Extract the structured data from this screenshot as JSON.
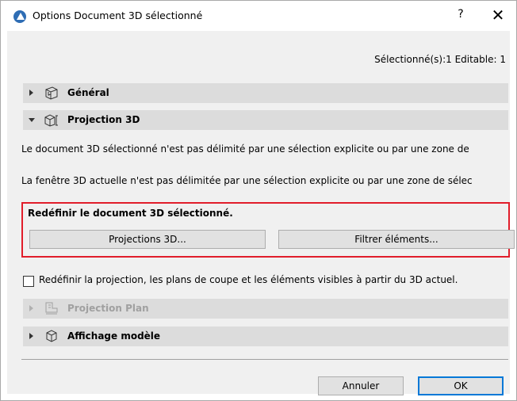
{
  "window": {
    "title": "Options Document 3D sélectionné",
    "help_label": "?",
    "close_label": "✕"
  },
  "status": {
    "selection_info": "Sélectionné(s):1 Editable: 1"
  },
  "sections": {
    "general": {
      "label": "Général",
      "expanded": false
    },
    "projection3d": {
      "label": "Projection 3D",
      "expanded": true
    },
    "projection_plan": {
      "label": "Projection Plan",
      "expanded": false,
      "enabled": false
    },
    "model_display": {
      "label": "Affichage modèle",
      "expanded": false
    }
  },
  "projection3d_panel": {
    "text1": "Le document 3D sélectionné n'est pas délimité par une sélection explicite ou par une zone de",
    "text2": "La fenêtre 3D actuelle n'est pas délimitée par une sélection explicite ou par une zone de sélec",
    "redefine_heading": "Redéfinir le document 3D sélectionné.",
    "projections_button": "Projections 3D...",
    "filter_button": "Filtrer éléments..."
  },
  "redefine_option": {
    "checked": false,
    "label": "Redéfinir la projection, les plans de coupe et les éléments visibles à partir du 3D actuel."
  },
  "footer": {
    "cancel_button": "Annuler",
    "ok_button": "OK"
  },
  "colors": {
    "highlight_border": "#e11d2a",
    "section_bar": "#dcdcdc",
    "accent": "#0078d7"
  }
}
